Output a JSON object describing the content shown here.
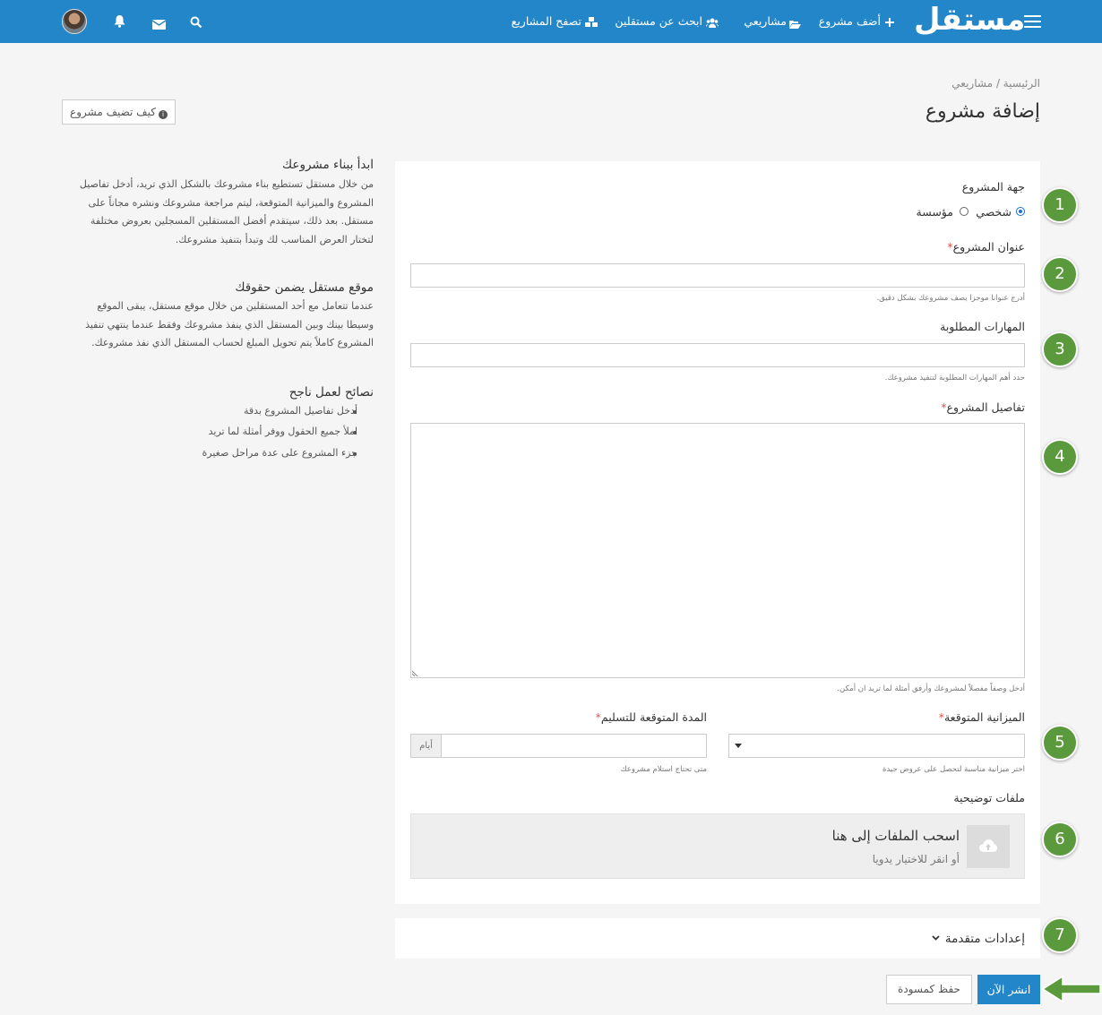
{
  "nav": {
    "logo": "مستقل",
    "add_project": "أضف مشروع",
    "my_projects": "مشاريعي",
    "find_freelancers": "ابحث عن مستقلين",
    "browse_projects": "تصفح المشاريع",
    "icons": [
      "menu-icon",
      "plus-icon",
      "folder-open-icon",
      "users-icon",
      "cubes-icon",
      "search-icon",
      "envelope-icon",
      "bell-icon",
      "user-avatar"
    ]
  },
  "breadcrumb": {
    "home": "الرئيسية",
    "separator": "/",
    "current": "مشاريعي"
  },
  "page_title": "إضافة مشروع",
  "howto_button": "كيف تضيف مشروع",
  "form": {
    "party_label": "جهة المشروع",
    "party_options": [
      {
        "label": "شخصي",
        "selected": true
      },
      {
        "label": "مؤسسة",
        "selected": false
      }
    ],
    "title_label": "عنوان المشروع",
    "title_hint": "أدرج عنوانا موجزا يصف مشروعك بشكل دقيق.",
    "skills_label": "المهارات المطلوبة",
    "skills_hint": "حدد أهم المهارات المطلوبة لتنفيذ مشروعك.",
    "details_label": "تفاصيل المشروع",
    "details_hint": "أدخل وصفاً مفصلاً لمشروعك وأرفق أمثلة لما تريد ان أمكن.",
    "budget_label": "الميزانية المتوقعة",
    "budget_hint": "اختر ميزانية مناسبة لتحصل على عروض جيدة",
    "duration_label": "المدة المتوقعة للتسليم",
    "duration_addon": "أيام",
    "duration_hint": "متى تحتاج استلام مشروعك",
    "required_mark": "*",
    "files_label": "ملفات توضيحية",
    "dropzone_title": "اسحب الملفات إلى هنا",
    "dropzone_sub": "أو انقر للاختيار يدويا",
    "advanced_label": "إعدادات متقدمة"
  },
  "buttons": {
    "publish": "انشر الآن",
    "draft": "حفظ كمسودة"
  },
  "sidebar": {
    "s1_title": "ابدأ ببناء مشروعك",
    "s1_text": "من خلال مستقل تستطيع بناء مشروعك بالشكل الذي تريد، أدخل تفاصيل المشروع والميزانية المتوقعة، ليتم مراجعة مشروعك ونشره مجاناً على مستقل. بعد ذلك، سيتقدم أفضل المستقلين المسجلين بعروض مختلفة لتختار العرض المناسب لك وتبدأ بتنفيذ مشروعك.",
    "s2_title": "موقع مستقل يضمن حقوقك",
    "s2_text": "عندما تتعامل مع أحد المستقلين من خلال موقع مستقل، يبقى الموقع وسيطا بينك وبين المستقل الذي ينفذ مشروعك وفقط عندما ينتهي تنفيذ المشروع كاملاً يتم تحويل المبلغ لحساب المستقل الذي نفذ مشروعك.",
    "s3_title": "نصائح لعمل ناجح",
    "tips": [
      "أدخل تفاصيل المشروع بدقة",
      "املأ جميع الحقول ووفر أمثلة لما تريد",
      "جزء المشروع على عدة مراحل صغيرة"
    ]
  },
  "steps": [
    "1",
    "2",
    "3",
    "4",
    "5",
    "6",
    "7"
  ],
  "colors": {
    "brand": "#2386c8",
    "step_badge": "#5b9a3c",
    "required": "#d9534f"
  }
}
